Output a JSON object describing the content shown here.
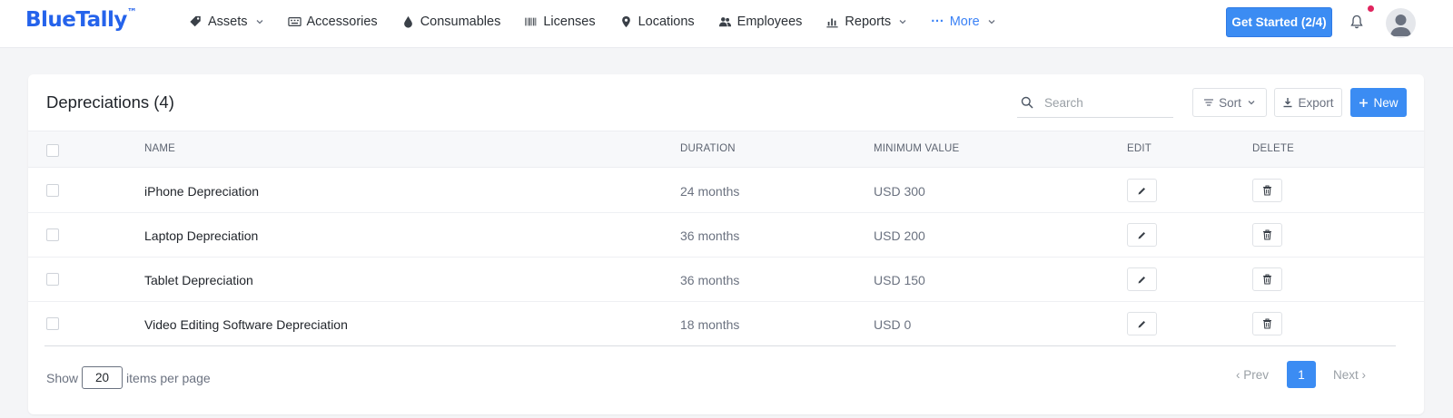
{
  "app": {
    "logo_text": "BlueTally",
    "logo_mark": "™"
  },
  "nav": {
    "items": [
      {
        "label": "Assets",
        "icon": "tag-icon",
        "has_dropdown": true
      },
      {
        "label": "Accessories",
        "icon": "keyboard-icon",
        "has_dropdown": false
      },
      {
        "label": "Consumables",
        "icon": "drop-icon",
        "has_dropdown": false
      },
      {
        "label": "Licenses",
        "icon": "barcode-icon",
        "has_dropdown": false
      },
      {
        "label": "Locations",
        "icon": "map-pin-icon",
        "has_dropdown": false
      },
      {
        "label": "Employees",
        "icon": "users-icon",
        "has_dropdown": false
      },
      {
        "label": "Reports",
        "icon": "bar-chart-icon",
        "has_dropdown": true
      }
    ],
    "more_label": "More",
    "get_started_label": "Get Started (2/4)"
  },
  "page": {
    "title": "Depreciations (4)",
    "search_placeholder": "Search",
    "sort_label": "Sort",
    "export_label": "Export",
    "new_label": "New"
  },
  "table": {
    "headers": {
      "name": "NAME",
      "duration": "DURATION",
      "min_value": "MINIMUM VALUE",
      "edit": "EDIT",
      "delete": "DELETE"
    },
    "rows": [
      {
        "name": "iPhone Depreciation",
        "duration": "24 months",
        "min_value": "USD 300"
      },
      {
        "name": "Laptop Depreciation",
        "duration": "36 months",
        "min_value": "USD 200"
      },
      {
        "name": "Tablet Depreciation",
        "duration": "36 months",
        "min_value": "USD 150"
      },
      {
        "name": "Video Editing Software Depreciation",
        "duration": "18 months",
        "min_value": "USD 0"
      }
    ]
  },
  "footer": {
    "show_label": "Show",
    "per_page_value": "20",
    "per_page_suffix": "items per page",
    "prev_label": "‹ Prev",
    "current_page": "1",
    "next_label": "Next ›"
  },
  "colors": {
    "accent": "#3b8cf3",
    "logo": "#2563eb",
    "notification_dot": "#e0245e"
  }
}
